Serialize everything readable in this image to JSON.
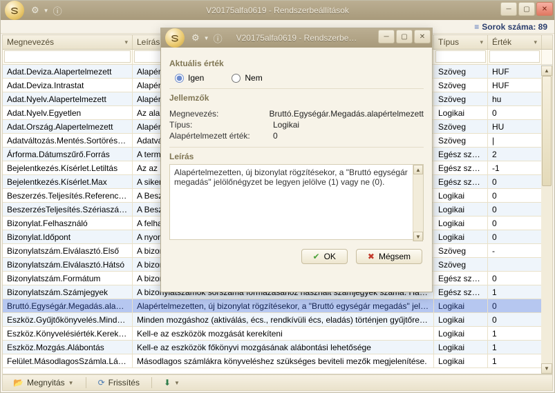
{
  "main": {
    "title": "V20175alfa0619 - Rendszerbeállítások",
    "row_count_label": "Sorok száma: 89"
  },
  "grid": {
    "headers": {
      "name": "Megnevezés",
      "desc": "Leírás",
      "type": "Típus",
      "val": "Érték"
    },
    "rows": [
      {
        "n": "Adat.Deviza.Alapertelmezett",
        "d": "Alapér…",
        "t": "Szöveg",
        "v": "HUF"
      },
      {
        "n": "Adat.Deviza.Intrastat",
        "d": "Alapért…",
        "t": "Szöveg",
        "v": "HUF"
      },
      {
        "n": "Adat.Nyelv.Alapertelmezett",
        "d": "Alapér…",
        "t": "Szöveg",
        "v": "hu"
      },
      {
        "n": "Adat.Nyelv.Egyetlen",
        "d": "Az alap…",
        "t": "Logikai",
        "v": "0"
      },
      {
        "n": "Adat.Ország.Alapertelmezett",
        "d": "Alapér…",
        "t": "Szöveg",
        "v": "HU"
      },
      {
        "n": "Adatváltozás.Mentés.SortörésHel…",
        "d": "Adatvá…",
        "t": "Szöveg",
        "v": "|"
      },
      {
        "n": "Árforma.Dátumszűrő.Forrás",
        "d": "A terme…",
        "t": "Egész szám",
        "v": "2"
      },
      {
        "n": "Bejelentkezés.Kísérlet.Letiltás",
        "d": "Az az id…",
        "t": "Egész szám",
        "v": "-1"
      },
      {
        "n": "Bejelentkezés.Kísérlet.Max",
        "d": "A siker…",
        "t": "Egész szám",
        "v": "0"
      },
      {
        "n": "Beszerzés.Teljesítés.Referencias…",
        "d": "A Besze…",
        "t": "Logikai",
        "v": "0"
      },
      {
        "n": "BeszerzésTeljesítés.Szériaszám.G…",
        "d": "A Besze…",
        "t": "Logikai",
        "v": "0"
      },
      {
        "n": "Bizonylat.Felhasználó",
        "d": "A felha…",
        "t": "Logikai",
        "v": "0"
      },
      {
        "n": "Bizonylat.Időpont",
        "d": "A nyom…",
        "t": "Logikai",
        "v": "0"
      },
      {
        "n": "Bizonylatszám.Elválasztó.Első",
        "d": "A bizon…",
        "t": "Szöveg",
        "v": "-"
      },
      {
        "n": "Bizonylatszám.Elválasztó.Hátsó",
        "d": "A bizon…",
        "t": "Szöveg",
        "v": ""
      },
      {
        "n": "Bizonylatszám.Formátum",
        "d": "A bizon…",
        "t": "Egész szám",
        "v": "0"
      },
      {
        "n": "Bizonylatszám.Számjegyek",
        "d": "A bizonylatszámok sorszáma formázasához használt számjegyek száma. Ha a sorsz…",
        "t": "Egész szám",
        "v": "1"
      },
      {
        "n": "Bruttó.Egységár.Megadás.alapér…",
        "d": "Alapértelmezetten, új bizonylat rögzítésekor, a \"Bruttó egységár megadás\" jelölőnég…",
        "t": "Logikai",
        "v": "0",
        "sel": true
      },
      {
        "n": "Eszköz.Gyűjtőkönyvelés.Mindenm…",
        "d": "Minden mozgáshoz (aktiválás, écs., rendkívüli écs, eladás) történjen gyűjtőre könyv…",
        "t": "Logikai",
        "v": "0"
      },
      {
        "n": "Eszköz.Könyvelésiérték.Kerekítés",
        "d": "Kell-e az eszközök mozgását kerekíteni",
        "t": "Logikai",
        "v": "1"
      },
      {
        "n": "Eszköz.Mozgás.Alábontás",
        "d": "Kell-e az eszközök főkönyvi mozgásának alábontási lehetősége",
        "t": "Logikai",
        "v": "1"
      },
      {
        "n": "Felület.MásodlagosSzámla.Látható",
        "d": "Másodlagos számlákra könyveléshez szükséges beviteli mezők megjelenítése.",
        "t": "Logikai",
        "v": "1"
      }
    ]
  },
  "toolbar": {
    "open": "Megnyitás",
    "refresh": "Frissítés"
  },
  "dialog": {
    "title": "V20175alfa0619 - Rendszerbe…",
    "current_value_label": "Aktuális érték",
    "radio_yes": "Igen",
    "radio_no": "Nem",
    "props_label": "Jellemzők",
    "name_label": "Megnevezés:",
    "name_value": "Bruttó.Egységár.Megadás.alapértelmezett",
    "type_label": "Típus:",
    "type_value": "Logikai",
    "default_label": "Alapértelmezett érték:",
    "default_value": "0",
    "desc_label": "Leírás",
    "desc_text": "Alapértelmezetten, új bizonylat rögzítésekor, a \"Bruttó egységár megadás\" jelölőnégyzet be legyen jelölve (1) vagy ne (0).",
    "ok": "OK",
    "cancel": "Mégsem"
  }
}
